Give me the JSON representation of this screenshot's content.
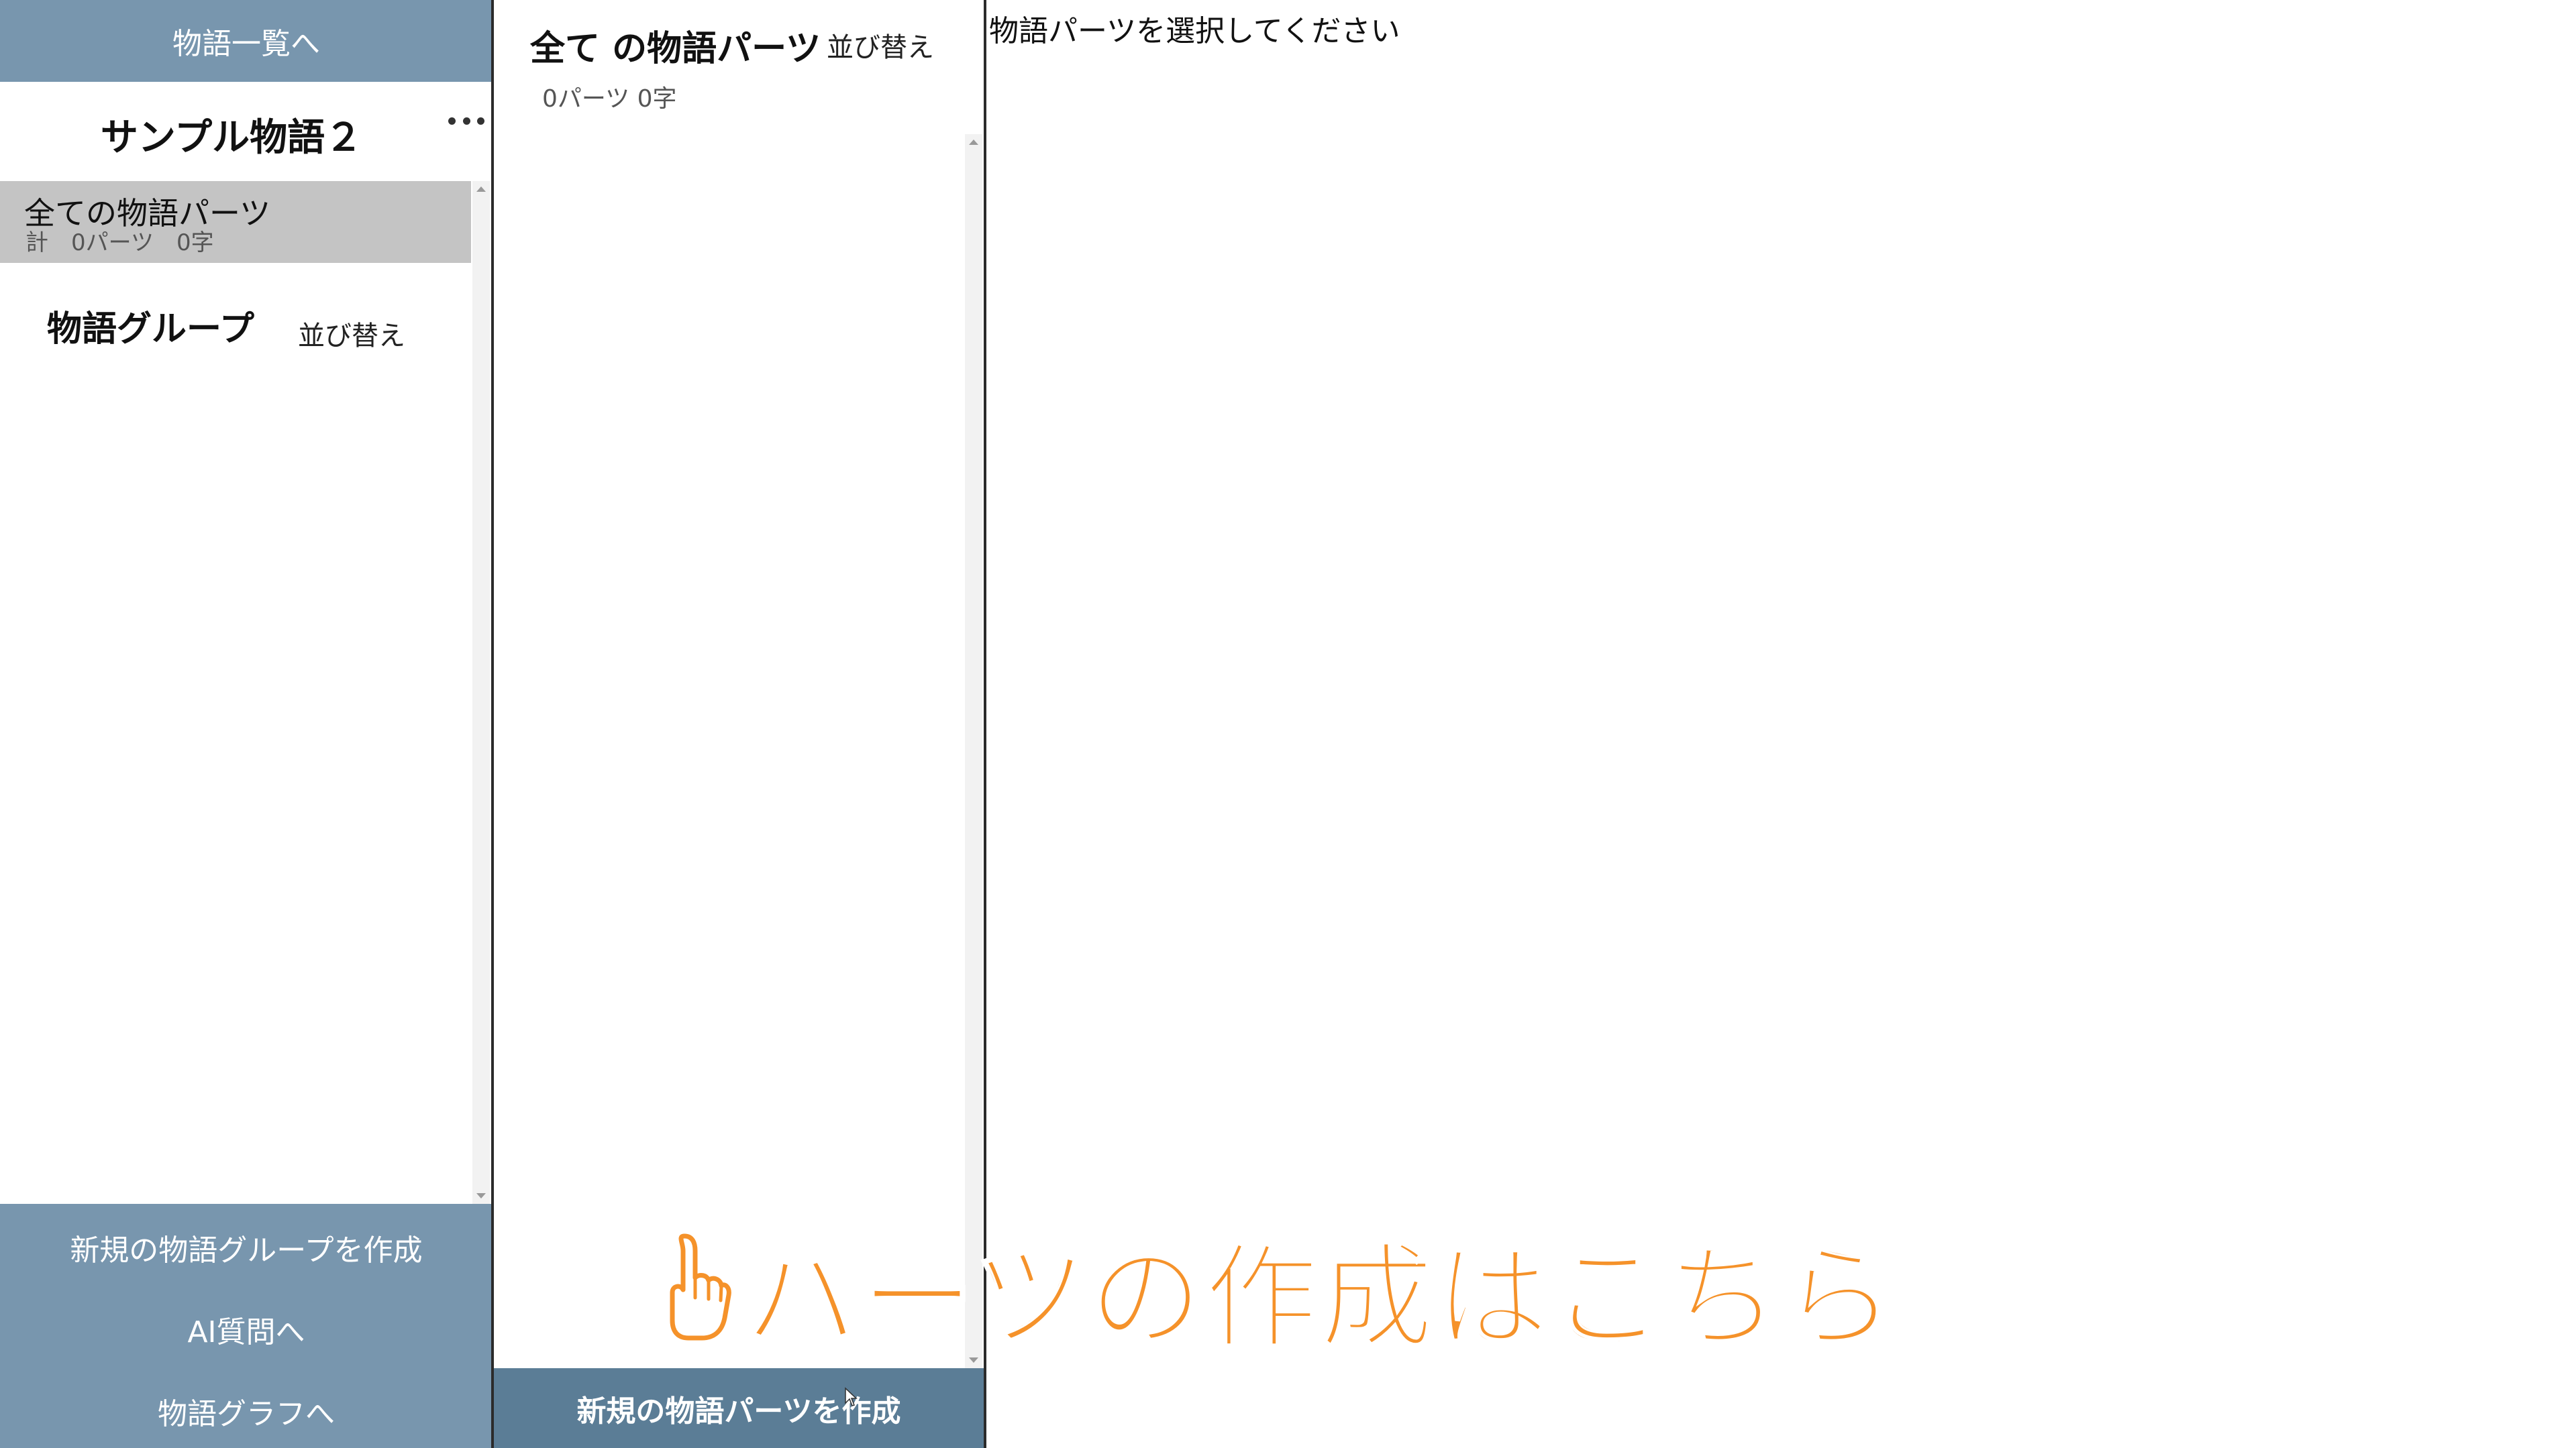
{
  "sidebar": {
    "back_to_list": "物語一覧へ",
    "story_title": "サンプル物語２",
    "all_parts": {
      "label": "全ての物語パーツ",
      "stats": "計　0パーツ　0字"
    },
    "group_heading": "物語グループ",
    "group_sort": "並び替え",
    "bottom_buttons": {
      "create_group": "新規の物語グループを作成",
      "ai_question": "AI質問へ",
      "story_graph": "物語グラフへ"
    }
  },
  "middle": {
    "title": "全て の物語パーツ",
    "sort": "並び替え",
    "stats": "0パーツ 0字",
    "create_part": "新規の物語パーツを作成"
  },
  "right": {
    "placeholder": "物語パーツを選択してください"
  },
  "overlay": {
    "callout": "パーツの作成はこちら",
    "icon": "pointing-hand-icon",
    "color": "#f5922a"
  },
  "colors": {
    "nav_blue": "#7896ae",
    "create_button": "#5b7d96",
    "selected_item": "#c4c4c4"
  }
}
